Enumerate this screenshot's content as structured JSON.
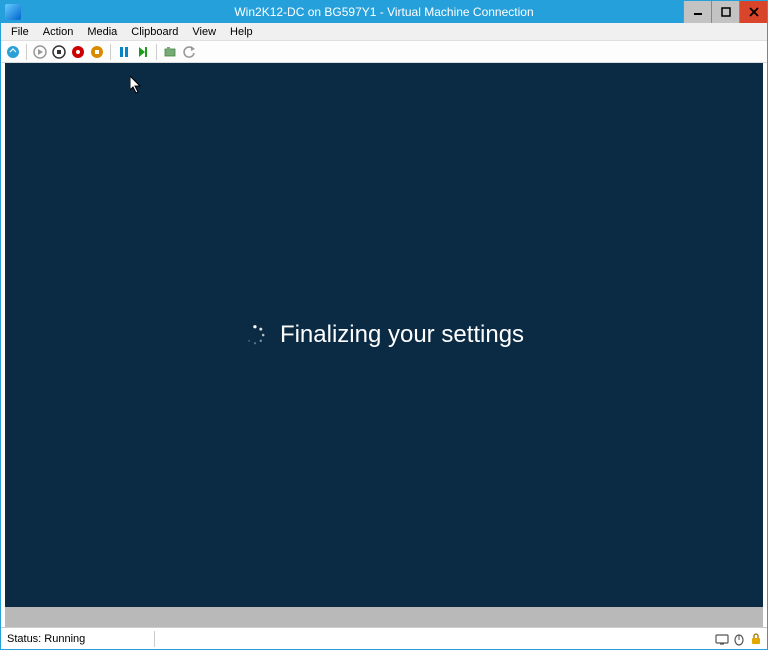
{
  "titlebar": {
    "title": "Win2K12-DC on BG597Y1 - Virtual Machine Connection"
  },
  "menu": {
    "file": "File",
    "action": "Action",
    "media": "Media",
    "clipboard": "Clipboard",
    "view": "View",
    "help": "Help"
  },
  "guest": {
    "message": "Finalizing your settings"
  },
  "status": {
    "text": "Status: Running"
  }
}
